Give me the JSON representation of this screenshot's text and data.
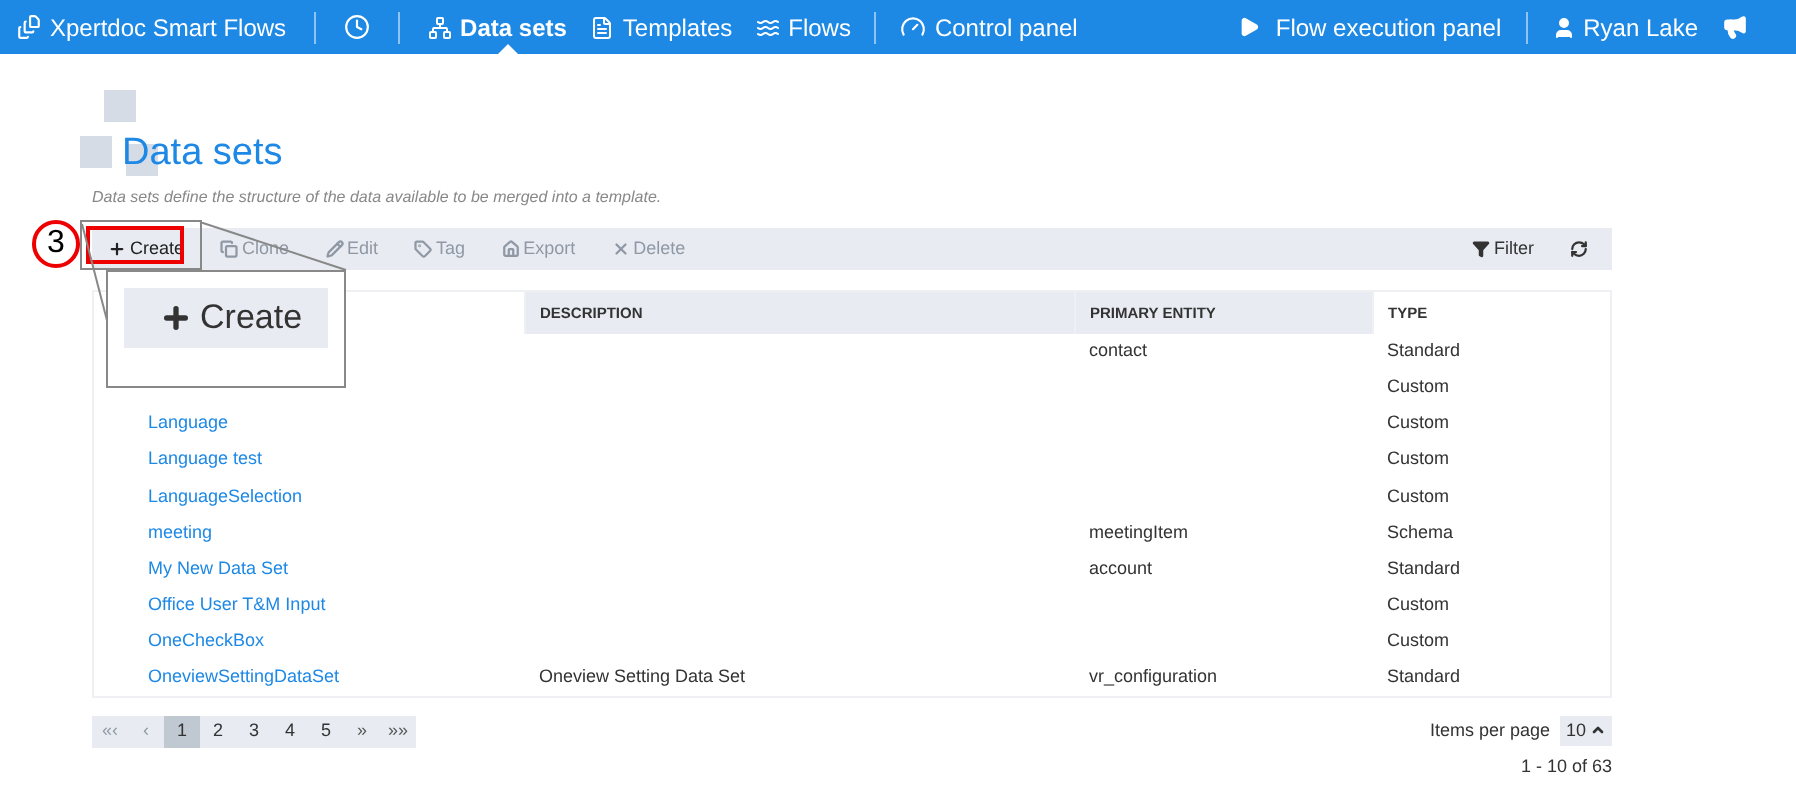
{
  "navbar": {
    "brand": "Xpertdoc Smart Flows",
    "items": [
      {
        "label": "Data sets",
        "selected": true
      },
      {
        "label": "Templates",
        "selected": false
      },
      {
        "label": "Flows",
        "selected": false
      }
    ],
    "control": "Control panel",
    "execution": "Flow execution panel",
    "user": "Ryan Lake"
  },
  "page": {
    "title": "Data sets",
    "subtitle": "Data sets define the structure of the data available to be merged into a template."
  },
  "toolbar": {
    "actions": [
      {
        "label": "Create",
        "disabled": false
      },
      {
        "label": "Clone",
        "disabled": true
      },
      {
        "label": "Edit",
        "disabled": true
      },
      {
        "label": "Tag",
        "disabled": true
      },
      {
        "label": "Export",
        "disabled": true
      },
      {
        "label": "Delete",
        "disabled": true
      }
    ],
    "filter": "Filter"
  },
  "table": {
    "columns": [
      "DESCRIPTION",
      "PRIMARY ENTITY",
      "TYPE"
    ],
    "rows": [
      {
        "entity": "contact",
        "type": "Standard"
      },
      {
        "type": "Custom"
      },
      {
        "name": "Language",
        "type": "Custom"
      },
      {
        "name": "Language test",
        "type": "Custom"
      },
      {
        "name": "LanguageSelection",
        "type": "Custom"
      },
      {
        "name": "meeting",
        "entity": "meetingItem",
        "type": "Schema"
      },
      {
        "name": "My New Data Set",
        "entity": "account",
        "type": "Standard"
      },
      {
        "name": "Office User T&M Input",
        "type": "Custom"
      },
      {
        "name": "OneCheckBox",
        "type": "Custom"
      },
      {
        "name": "OneviewSettingDataSet",
        "description": "Oneview Setting Data Set",
        "entity": "vr_configuration",
        "type": "Standard"
      }
    ]
  },
  "pagination": {
    "pages": [
      {
        "label": "«‹",
        "kind": "nav"
      },
      {
        "label": "‹",
        "kind": "nav"
      },
      {
        "label": "1",
        "kind": "page",
        "selected": true
      },
      {
        "label": "2",
        "kind": "page",
        "selected": false
      },
      {
        "label": "3",
        "kind": "page",
        "selected": false
      },
      {
        "label": "4",
        "kind": "page",
        "selected": false
      },
      {
        "label": "5",
        "kind": "page",
        "selected": false
      },
      {
        "label": "»",
        "kind": "nav"
      },
      {
        "label": "»»",
        "kind": "nav"
      }
    ],
    "items_per_page_label": "Items per page",
    "items_per_page": "10",
    "range": "1 - 10 of 63"
  },
  "annotation": {
    "number": "3",
    "zoomed_label": "Create"
  }
}
